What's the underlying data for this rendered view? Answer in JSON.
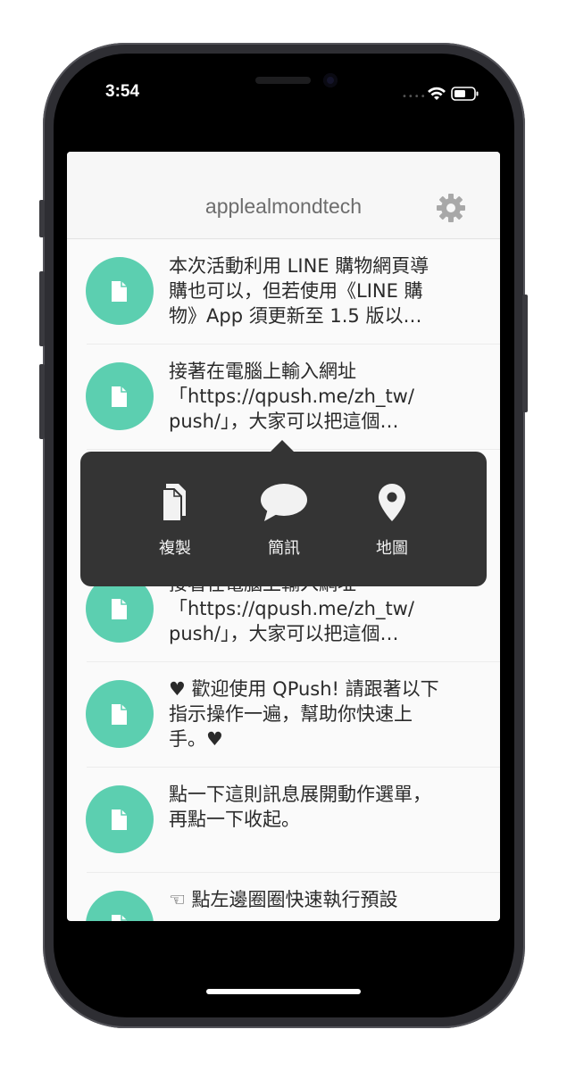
{
  "status_bar": {
    "time": "3:54"
  },
  "header": {
    "title": "applealmondtech"
  },
  "messages": [
    {
      "text": "本次活動利用 LINE 購物網頁導\n購也可以，但若使用《LINE 購\n物》App 須更新至 1.5 版以…"
    },
    {
      "text": "接著在電腦上輸入網址\n「https://qpush.me/zh_tw/\npush/」，大家可以把這個…"
    },
    {
      "text": "接著在電腦上輸入網址\n「https://qpush.me/zh_tw/\npush/」，大家可以把這個…"
    },
    {
      "text": "♥ 歡迎使用 QPush! 請跟著以下\n指示操作一遍，幫助你快速上\n手。♥"
    },
    {
      "text": "點一下這則訊息展開動作選單，\n再點一下收起。"
    },
    {
      "text": "☜ 點左邊圈圈快速執行預設"
    }
  ],
  "popup": {
    "actions": [
      {
        "label": "複製",
        "icon": "copy-icon"
      },
      {
        "label": "簡訊",
        "icon": "message-bubble-icon"
      },
      {
        "label": "地圖",
        "icon": "map-pin-icon"
      }
    ]
  },
  "colors": {
    "accent": "#5ccfb0",
    "popup_bg": "#343434",
    "header_text": "#6d6d6d"
  }
}
